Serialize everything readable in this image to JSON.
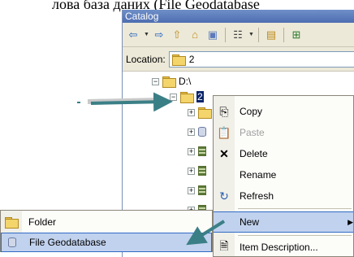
{
  "document_text": "лова база даних (File Geodatabase",
  "window": {
    "title": "Catalog"
  },
  "toolbar": {
    "icons": [
      "back-arrow-icon",
      "forward-arrow-icon",
      "up-folder-icon",
      "home-icon",
      "connect-icon",
      "view-options-icon",
      "new-folder-icon",
      "tree-icon"
    ]
  },
  "location": {
    "label": "Location:",
    "value": "2"
  },
  "tree": {
    "root": {
      "label": "D:\\",
      "expander": "−"
    },
    "selected": {
      "label": "2",
      "expander": "−"
    },
    "children_expander": "+"
  },
  "context_menu": {
    "items": [
      {
        "label": "Copy",
        "icon": "copy-icon"
      },
      {
        "label": "Paste",
        "icon": "paste-icon",
        "disabled": true
      },
      {
        "label": "Delete",
        "icon": "delete-icon"
      },
      {
        "label": "Rename"
      },
      {
        "label": "Refresh",
        "icon": "refresh-icon"
      },
      {
        "label": "New",
        "submenu_arrow": "▶",
        "highlight": true
      },
      {
        "label": "Item Description...",
        "icon": "item-description-icon"
      }
    ]
  },
  "submenu": {
    "items": [
      {
        "label": "Folder",
        "icon": "folder-icon"
      },
      {
        "label": "File Geodatabase",
        "icon": "file-geodatabase-icon",
        "highlight": true
      }
    ]
  },
  "colors": {
    "title_bar": "#5a7abc",
    "highlight": "#c1d2ee",
    "highlight_border": "#316ac5",
    "arrow": "#3b7f86",
    "selection": "#0a246a"
  }
}
